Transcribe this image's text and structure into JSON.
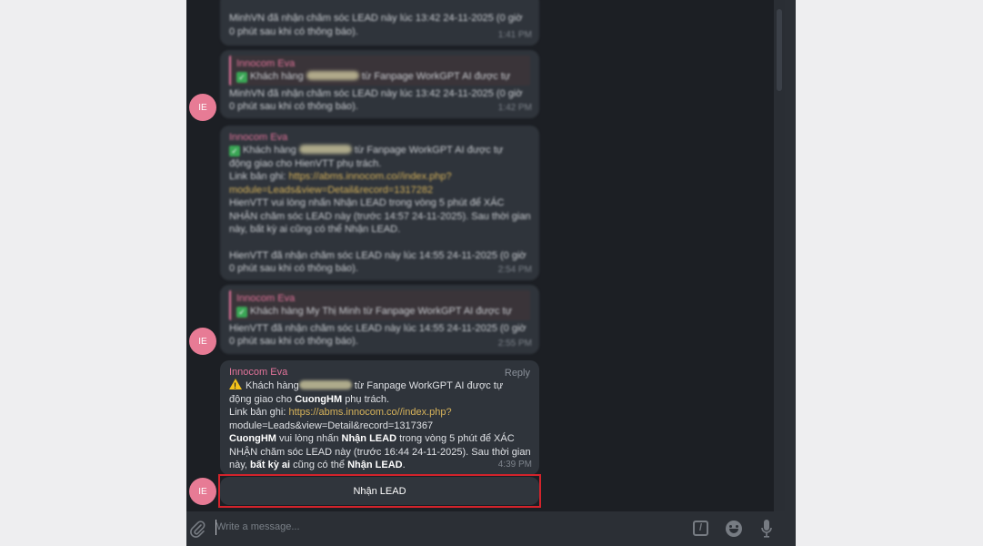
{
  "colors": {
    "sender": "#e2739a",
    "link": "#d6b25a",
    "highlight": "#d3232b",
    "avatar": "#e77b95"
  },
  "messages": [
    {
      "lines": [
        "MinhVN đã nhận chăm sóc LEAD này lúc 13:42 24-11-2025 (0 giờ",
        "0 phút sau khi có thông báo)."
      ],
      "time": "1:41 PM"
    },
    {
      "sender": "Innocom Eva",
      "quote_line": "Khách hàng",
      "quote_rest": "từ Fanpage WorkGPT AI được tự",
      "lines": [
        "MinhVN đã nhận chăm sóc LEAD này lúc 13:42 24-11-2025 (0 giờ",
        "0 phút sau khi có thông báo)."
      ],
      "time": "1:42 PM",
      "avatar": "IE"
    },
    {
      "sender": "Innocom Eva",
      "first_a": "Khách hàng",
      "first_b": "từ Fanpage WorkGPT AI được tự",
      "lines": [
        "động giao cho HienVTT phụ trách."
      ],
      "link_label": "Link bản ghi:",
      "link1": "https://abms.innocom.co//index.php?",
      "link2": "module=Leads&view=Detail&record=1317282",
      "lines2": [
        "HienVTT vui lòng nhấn Nhận LEAD trong vòng 5 phút để XÁC",
        "NHẬN chăm sóc LEAD này (trước 14:57 24-11-2025). Sau thời gian",
        "này, bất kỳ ai cũng có thể Nhận LEAD."
      ],
      "lines3": [
        "HienVTT đã nhận chăm sóc LEAD này lúc 14:55 24-11-2025 (0 giờ",
        "0 phút sau khi có thông báo)."
      ],
      "time": "2:54 PM"
    },
    {
      "sender": "Innocom Eva",
      "quote_line": "Khách hàng My Thị Minh từ Fanpage WorkGPT AI được tự",
      "lines": [
        "HienVTT đã nhận chăm sóc LEAD này lúc 14:55 24-11-2025 (0 giờ",
        "0 phút sau khi có thông báo)."
      ],
      "time": "2:55 PM",
      "avatar": "IE"
    },
    {
      "sender": "Innocom Eva",
      "reply": "Reply",
      "first_a": "Khách hàng",
      "first_b": "từ Fanpage WorkGPT AI được tự",
      "assign_a": "động giao cho",
      "assign_b": "CuongHM",
      "assign_c": "phụ trách.",
      "link_label": "Link bản ghi:",
      "link1": "https://abms.innocom.co//index.php?",
      "link2": "module=Leads&view=Detail&record=1317367",
      "p1_a": "CuongHM",
      "p1_b": "vui lòng nhấn",
      "p1_c": "Nhận LEAD",
      "p1_d": "trong vòng 5 phút để XÁC",
      "p2": "NHẬN chăm sóc LEAD này (trước 16:44 24-11-2025). Sau thời gian",
      "p3_a": "này,",
      "p3_b": "bất kỳ ai",
      "p3_c": "cũng có thể",
      "p3_d": "Nhận LEAD",
      "p3_e": ".",
      "time": "4:39 PM",
      "avatar": "IE"
    }
  ],
  "action_button": "Nhận LEAD",
  "composer": {
    "placeholder": "Write a message...",
    "command_glyph": "/"
  },
  "icons": [
    "paperclip-icon",
    "command-icon",
    "emoji-icon",
    "microphone-icon",
    "warning-icon",
    "checkmark-icon"
  ]
}
